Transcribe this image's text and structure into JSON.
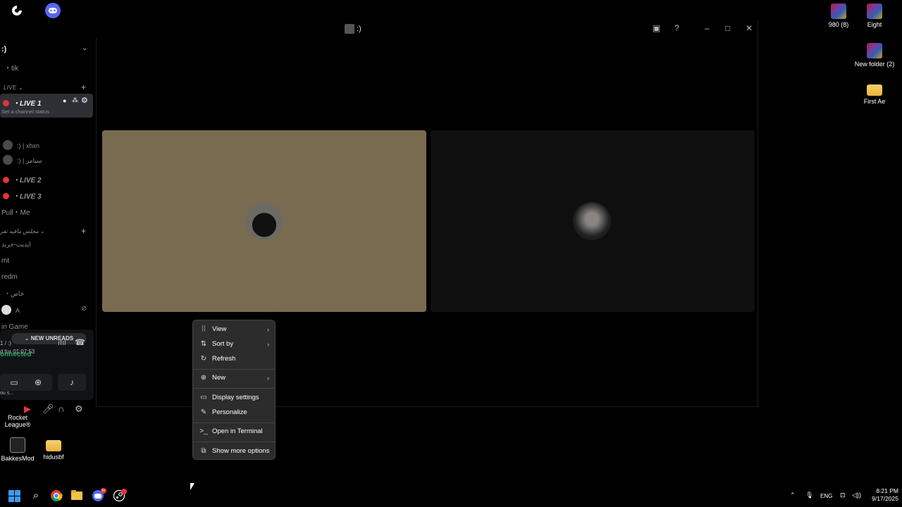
{
  "desktop": {
    "top_left_icons": [
      "logitech-icon",
      "discord-icon"
    ],
    "right_icons": [
      {
        "label": "980 (8)",
        "kind": "rar"
      },
      {
        "label": "Eight",
        "kind": "rar"
      },
      {
        "label": "New folder (2)",
        "kind": "rar"
      },
      {
        "label": "First Ae",
        "kind": "folder"
      }
    ],
    "left_icons": [
      {
        "label": "Rocket League®"
      },
      {
        "label": "BakkesMod"
      },
      {
        "label": "hidusbf"
      }
    ]
  },
  "window": {
    "title": ":)",
    "controls": [
      "inbox-icon",
      "help-icon",
      "minimize-icon",
      "maximize-icon",
      "close-icon"
    ]
  },
  "sidebar": {
    "server_name": ":)",
    "channels": {
      "tik": "tik",
      "cat_live": "LIVE",
      "live1": "LIVE 1",
      "live1_status": "Set a channel status",
      "user1": ":) | xhxn",
      "user2": ":) | سیامر",
      "live2": "LIVE 2",
      "live3": "LIVE 3",
      "pull": "Pull・Me",
      "cat2": "مجلس مافیه نفر",
      "ch_editor": "ایدیت-خرید",
      "mt": "mt",
      "redm": "redm",
      "khas": "خاص",
      "user_a": "A",
      "in_game": "in Game",
      "smile": ":)"
    },
    "new_unreads": "NEW UNREADS",
    "voice": {
      "status": "onnected",
      "channel": "1 / :)",
      "timer": "d for 01:07:53"
    },
    "footer_user": "ou s..."
  },
  "context_menu": {
    "items": [
      {
        "label": "View",
        "icon": "grid-icon",
        "submenu": true
      },
      {
        "label": "Sort by",
        "icon": "sort-icon",
        "submenu": true
      },
      {
        "label": "Refresh",
        "icon": "refresh-icon",
        "submenu": false
      },
      {
        "label": "New",
        "icon": "new-icon",
        "submenu": true
      },
      {
        "label": "Display settings",
        "icon": "display-icon",
        "submenu": false
      },
      {
        "label": "Personalize",
        "icon": "brush-icon",
        "submenu": false
      },
      {
        "label": "Open in Terminal",
        "icon": "terminal-icon",
        "submenu": false
      },
      {
        "label": "Show more options",
        "icon": "more-options-icon",
        "submenu": false
      }
    ]
  },
  "taskbar": {
    "tray_lang": "ENG",
    "time": "8:21 PM",
    "date": "9/17/2025",
    "discord_badge": "9+"
  },
  "colors": {
    "live_red": "#e3353b",
    "connected_green": "#23a55a",
    "tile_left": "#796b4f",
    "tile_right": "#0f0f0f",
    "menu_bg": "#2c2c2c"
  }
}
